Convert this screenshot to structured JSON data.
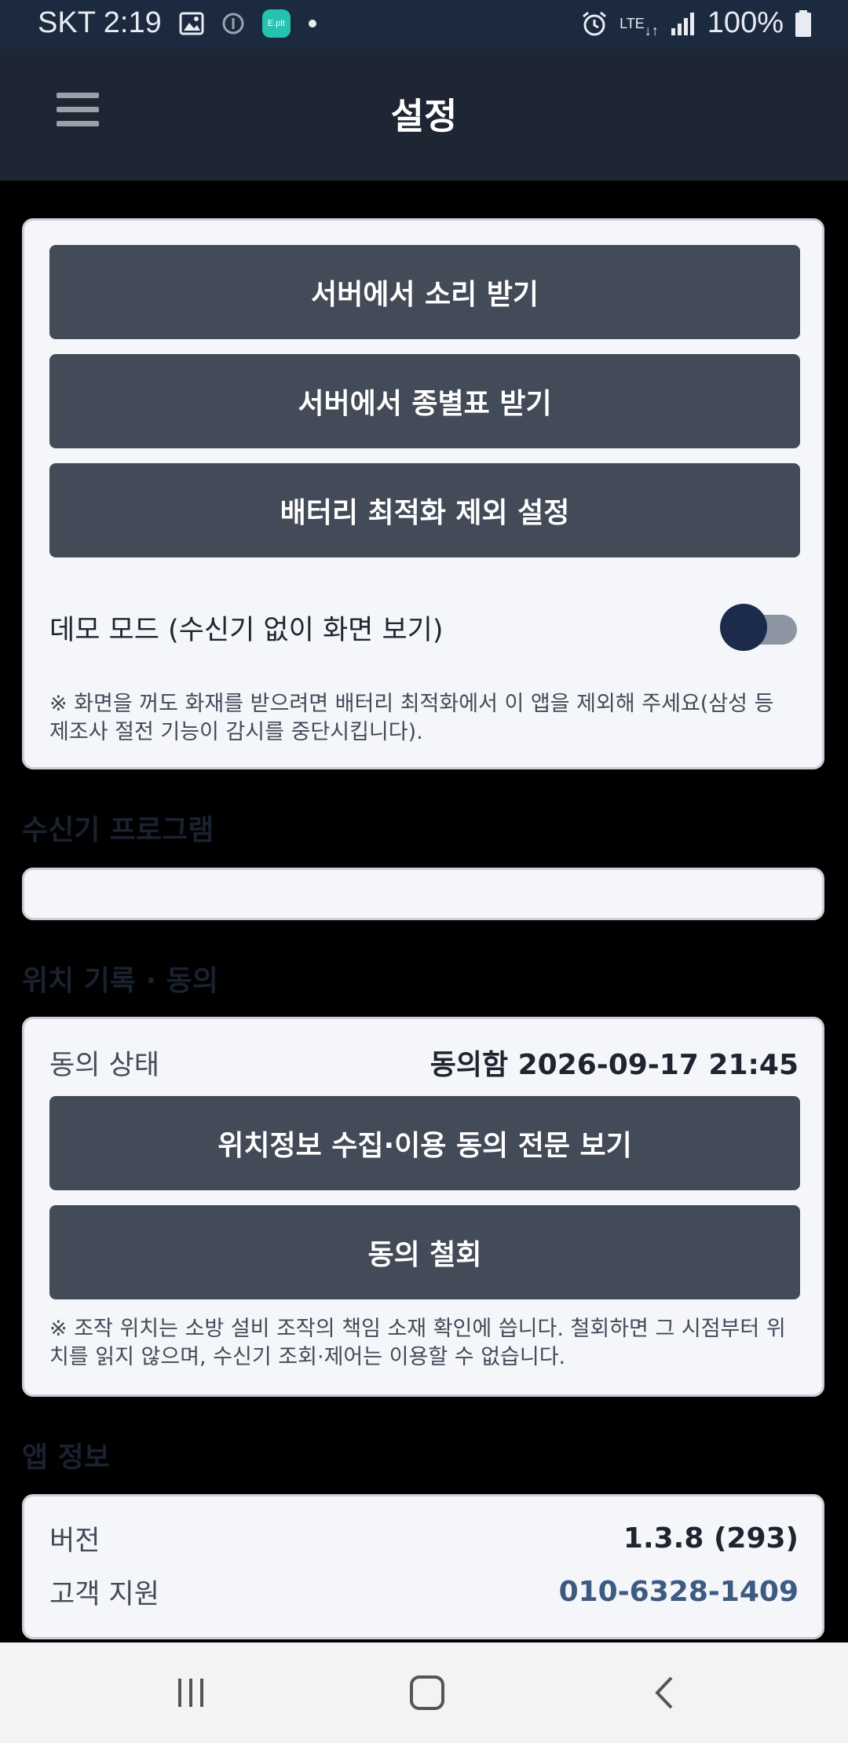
{
  "status_bar": {
    "carrier": "SKT",
    "time": "2:19",
    "lte_label": "LTE",
    "battery": "100%",
    "app_badge": "E.plt",
    "icons": [
      "gallery-icon",
      "info-circle-icon",
      "eplt-app-icon",
      "dot-icon",
      "alarm-icon",
      "lte-icon",
      "signal-icon",
      "battery-icon"
    ]
  },
  "app_bar": {
    "title": "설정",
    "menu_icon": "hamburger-menu-icon"
  },
  "sound_card": {
    "buttons": [
      "서버에서 소리 받기",
      "서버에서 종별표 받기",
      "배터리 최적화 제외 설정"
    ],
    "demo_mode_label": "데모 모드 (수신기 없이 화면 보기)",
    "demo_mode_on": true,
    "note": "※ 화면을 꺼도 화재를 받으려면 배터리 최적화에서 이 앱을 제외해 주세요(삼성 등 제조사 절전 기능이 감시를 중단시킵니다)."
  },
  "receiver_section": {
    "title": "수신기 프로그램"
  },
  "location_section": {
    "title": "위치 기록 · 동의",
    "consent_key": "동의 상태",
    "consent_value": "동의함 2026-09-17 21:45",
    "buttons": [
      "위치정보 수집·이용 동의 전문 보기",
      "동의 철회"
    ],
    "note": "※ 조작 위치는 소방 설비 조작의 책임 소재 확인에 씁니다. 철회하면 그 시점부터 위치를 읽지 않으며, 수신기 조회·제어는 이용할 수 없습니다."
  },
  "app_info": {
    "title": "앱 정보",
    "version_key": "버전",
    "version_value": "1.3.8 (293)",
    "support_key": "고객 지원",
    "support_value": "010-6328-1409"
  },
  "colors": {
    "appbar": "#1e2533",
    "button": "#434a58",
    "card": "#f4f6fa",
    "toggle_knob": "#1c2b4b",
    "link": "#3d5a80"
  },
  "nav_bar": {
    "icons": [
      "recent-apps-icon",
      "home-icon",
      "back-icon"
    ]
  }
}
